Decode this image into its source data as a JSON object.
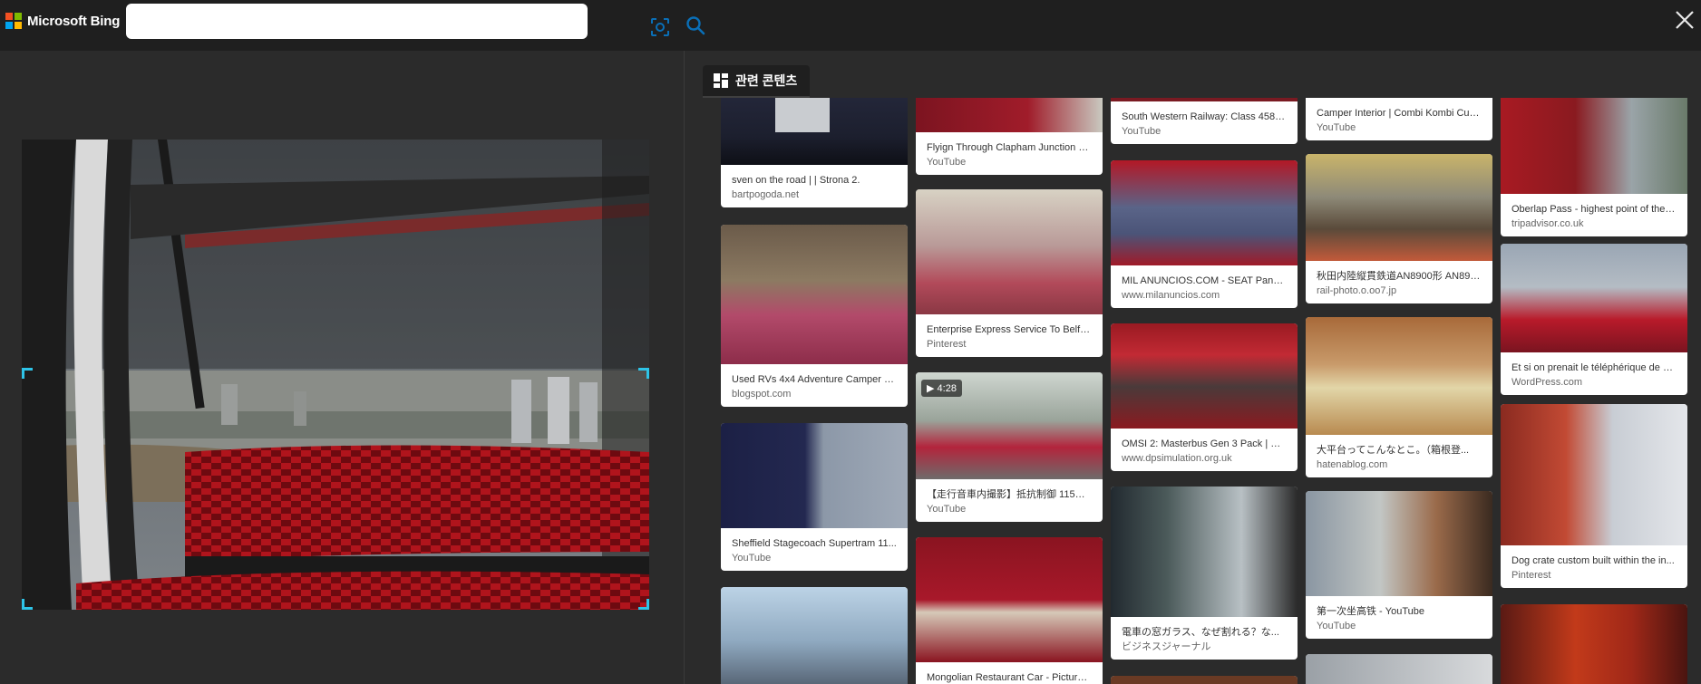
{
  "brand": {
    "name": "Microsoft Bing",
    "colors": [
      "#f25022",
      "#7fba00",
      "#00a4ef",
      "#ffb900"
    ]
  },
  "search": {
    "value": "",
    "placeholder": ""
  },
  "related": {
    "tab_label": "관련 콘텐츠"
  },
  "icons": {
    "visual_search": "visual-search-icon",
    "search": "search-icon",
    "close": "close-icon",
    "related": "grid-icon",
    "play": "play-icon"
  },
  "accent": "#2ec4e8",
  "columns": [
    {
      "cards": [
        {
          "title": "sven on the road | | Strona 2.",
          "source": "bartpogoda.net"
        },
        {
          "title": "Used RVs 4x4 Adventure Camper V...",
          "source": "blogspot.com"
        },
        {
          "title": "Sheffield Stagecoach Supertram 11...",
          "source": "YouTube"
        },
        {
          "title": "",
          "source": ""
        }
      ]
    },
    {
      "cards": [
        {
          "title": "Flyign Through Clapham Junction O...",
          "source": "YouTube"
        },
        {
          "title": "Enterprise Express Service To Belfa...",
          "source": "Pinterest"
        },
        {
          "title": "【走行音車内撮影】抵抗制御 115系 ...",
          "source": "YouTube",
          "duration": "4:28"
        },
        {
          "title": "Mongolian Restaurant Car - Picture ...",
          "source": ""
        }
      ]
    },
    {
      "cards": [
        {
          "title": "South Western Railway: Class 458 5...",
          "source": "YouTube"
        },
        {
          "title": "MIL ANUNCIOS.COM - SEAT Panda ...",
          "source": "www.milanuncios.com"
        },
        {
          "title": "OMSI 2: Masterbus Gen 3 Pack | Bu...",
          "source": "www.dpsimulation.org.uk"
        },
        {
          "title": "電車の窓ガラス、なぜ割れる？な...",
          "source": "ビジネスジャーナル"
        },
        {
          "title": "",
          "source": ""
        }
      ]
    },
    {
      "cards": [
        {
          "title": "Camper Interior | Combi Kombi Cust...",
          "source": "YouTube"
        },
        {
          "title": "秋田内陸縦貫鉄道AN8900形 AN890...",
          "source": "rail-photo.o.oo7.jp"
        },
        {
          "title": "大平台ってこんなとこ。（箱根登...",
          "source": "hatenablog.com"
        },
        {
          "title": "第一次坐高铁 - YouTube",
          "source": "YouTube"
        },
        {
          "title": "",
          "source": ""
        }
      ]
    },
    {
      "cards": [
        {
          "title": "Oberlap Pass - highest point of the j...",
          "source": "tripadvisor.co.uk"
        },
        {
          "title": "Et si on prenait le téléphérique de L...",
          "source": "WordPress.com"
        },
        {
          "title": "Dog crate custom built within the in...",
          "source": "Pinterest"
        },
        {
          "title": "",
          "source": ""
        }
      ]
    }
  ]
}
